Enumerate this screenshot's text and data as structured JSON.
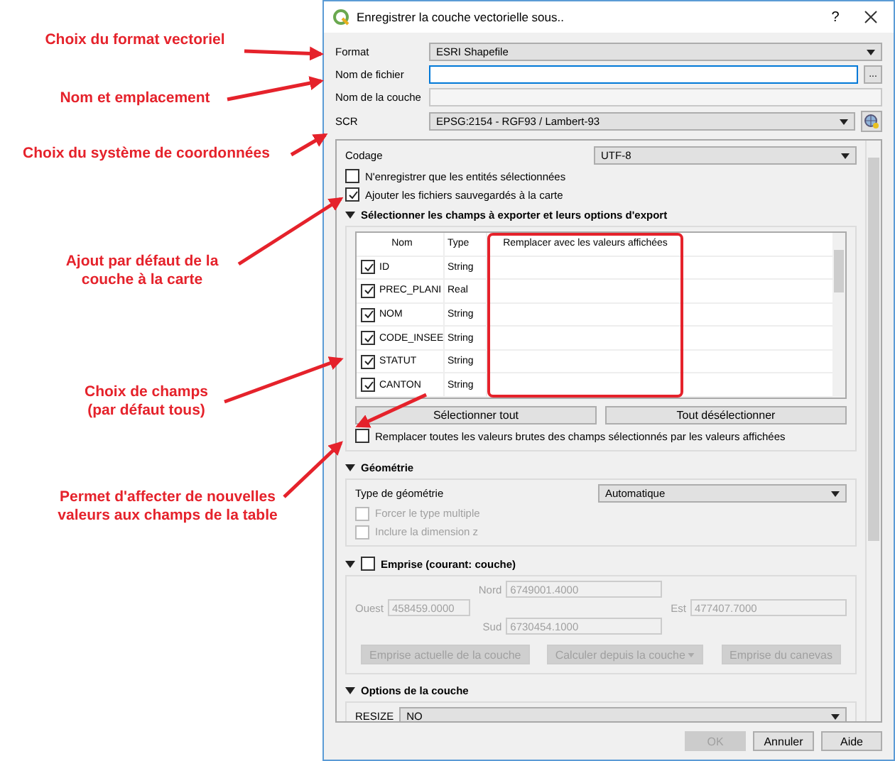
{
  "annotations": [
    {
      "text": "Choix du format vectoriel"
    },
    {
      "text": "Nom et emplacement"
    },
    {
      "text": "Choix du système de coordonnées"
    },
    {
      "text": "Ajout par défaut de la\ncouche à la carte"
    },
    {
      "text": "Choix de champs\n(par défaut tous)"
    },
    {
      "text": "Permet d'affecter de nouvelles\nvaleurs aux champs de la table"
    }
  ],
  "window": {
    "title": "Enregistrer la couche vectorielle sous..",
    "help": "?"
  },
  "top_fields": [
    {
      "label": "Format",
      "kind": "combo",
      "value": "ESRI Shapefile"
    },
    {
      "label": "Nom de fichier",
      "kind": "file",
      "focused": true,
      "browse": "..."
    },
    {
      "label": "Nom de la couche",
      "kind": "input",
      "focused": false
    },
    {
      "label": "SCR",
      "kind": "crs",
      "value": "EPSG:2154 - RGF93 / Lambert-93"
    }
  ],
  "encoding": {
    "label": "Codage",
    "value": "UTF-8"
  },
  "options": [
    {
      "label": "N'enregistrer que les entités sélectionnées",
      "checked": false
    },
    {
      "label": "Ajouter les fichiers sauvegardés à la carte",
      "checked": true
    }
  ],
  "fields_group": {
    "title": "Sélectionner les champs à exporter et leurs options d'export",
    "expanded": true,
    "columns": [
      "Nom",
      "Type",
      "Remplacer avec les valeurs affichées"
    ],
    "rows": [
      {
        "name": "ID",
        "type": "String",
        "checked": true
      },
      {
        "name": "PREC_PLANI",
        "type": "Real",
        "checked": true
      },
      {
        "name": "NOM",
        "type": "String",
        "checked": true
      },
      {
        "name": "CODE_INSEE",
        "type": "String",
        "checked": true
      },
      {
        "name": "STATUT",
        "type": "String",
        "checked": true
      },
      {
        "name": "CANTON",
        "type": "String",
        "checked": true
      }
    ],
    "buttons": [
      "Sélectionner tout",
      "Tout désélectionner"
    ],
    "replace_all": {
      "label": "Remplacer toutes les valeurs brutes des champs sélectionnés par les valeurs affichées",
      "checked": false
    }
  },
  "geometry": {
    "title": "Géométrie",
    "expanded": true,
    "type_label": "Type de géométrie",
    "type_value": "Automatique",
    "options": [
      {
        "label": "Forcer le type multiple",
        "checked": false,
        "disabled": true
      },
      {
        "label": "Inclure la dimension z",
        "checked": false,
        "disabled": true
      }
    ]
  },
  "extent": {
    "title": "Emprise (courant: couche)",
    "expanded": true,
    "checked": false,
    "disabled": true,
    "north": {
      "label": "Nord",
      "value": "6749001.4000"
    },
    "west": {
      "label": "Ouest",
      "value": "458459.0000"
    },
    "east": {
      "label": "Est",
      "value": "477407.7000"
    },
    "south": {
      "label": "Sud",
      "value": "6730454.1000"
    },
    "buttons": [
      {
        "label": "Emprise actuelle de la couche",
        "menu": false
      },
      {
        "label": "Calculer depuis la couche",
        "menu": true
      },
      {
        "label": "Emprise du canevas",
        "menu": false
      }
    ]
  },
  "layer_options": {
    "title": "Options de la couche",
    "expanded": true,
    "rows": [
      {
        "label": "RESIZE",
        "value": "NO"
      }
    ]
  },
  "buttons": [
    {
      "label": "OK",
      "disabled": true
    },
    {
      "label": "Annuler",
      "disabled": false
    },
    {
      "label": "Aide",
      "disabled": false
    }
  ]
}
